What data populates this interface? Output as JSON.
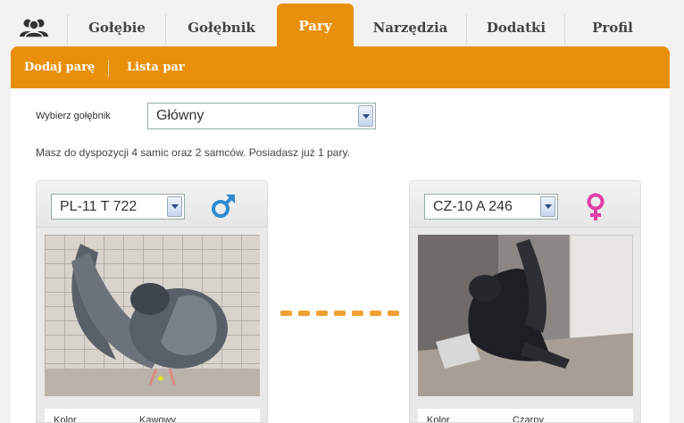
{
  "tabs": [
    {
      "label": "Gołębie"
    },
    {
      "label": "Gołębnik"
    },
    {
      "label": "Pary"
    },
    {
      "label": "Narzędzia"
    },
    {
      "label": "Dodatki"
    },
    {
      "label": "Profil"
    }
  ],
  "active_tab": "Pary",
  "subnav": {
    "add_pair": "Dodaj parę",
    "pair_list": "Lista par"
  },
  "loft": {
    "label": "Wybierz gołębnik",
    "selected": "Główny"
  },
  "info_text": "Masz do dyspozycji 4 samic oraz 2 samców. Posiadasz już 1 pary.",
  "male": {
    "ring": "PL-11 T 722",
    "attr_label": "Kolor",
    "attr_value": "Kawowy"
  },
  "female": {
    "ring": "CZ-10 A 246",
    "attr_label": "Kolor",
    "attr_value": "Czarny"
  },
  "colors": {
    "accent": "#e8900c",
    "male_icon": "#2e8bd0",
    "female_icon": "#e040a8"
  },
  "icons": [
    "users-icon",
    "male-symbol-icon",
    "female-symbol-icon",
    "chevron-down-icon"
  ]
}
